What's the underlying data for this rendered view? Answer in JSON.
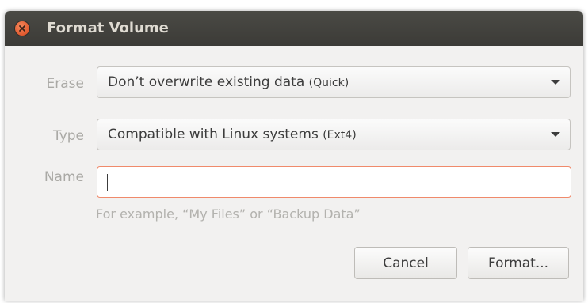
{
  "window": {
    "title": "Format Volume"
  },
  "form": {
    "erase": {
      "label": "Erase",
      "value": "Don’t overwrite existing data",
      "hint": "(Quick)"
    },
    "type": {
      "label": "Type",
      "value": "Compatible with Linux systems",
      "hint": "(Ext4)"
    },
    "name": {
      "label": "Name",
      "value": "",
      "example": "For example, “My Files” or “Backup Data”"
    }
  },
  "buttons": {
    "cancel": "Cancel",
    "format": "Format..."
  },
  "icons": {
    "close": "close-icon",
    "dropdown": "chevron-down-icon"
  },
  "colors": {
    "titlebar": "#3c3b37",
    "close_button": "#e0592e",
    "entry_border": "#f08a6b"
  }
}
